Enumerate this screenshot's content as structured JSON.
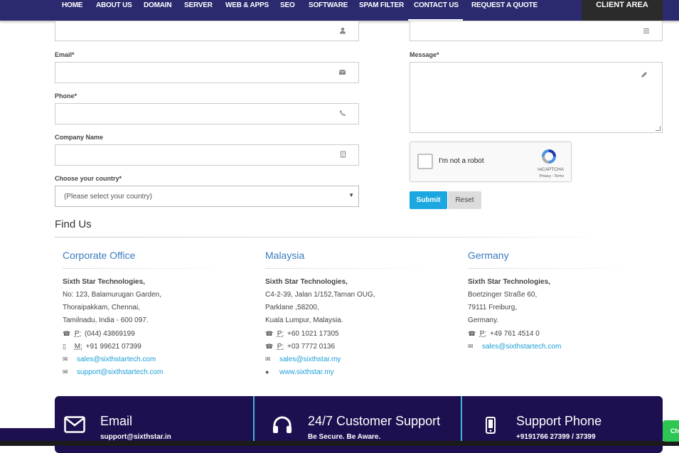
{
  "nav": {
    "items": [
      "HOME",
      "ABOUT US",
      "DOMAIN",
      "SERVER",
      "WEB & APPS",
      "SEO",
      "SOFTWARE",
      "SPAM FILTER",
      "CONTACT US",
      "REQUEST A QUOTE"
    ],
    "active": "CONTACT US",
    "client_area": "CLIENT AREA"
  },
  "form": {
    "email_label": "Email*",
    "phone_label": "Phone*",
    "company_label": "Company Name",
    "country_label": "Choose your country*",
    "country_selected": "(Please select your country)",
    "message_label": "Message*",
    "captcha_text": "I'm not a robot",
    "captcha_brand": "reCAPTCHA",
    "captcha_terms": "Privacy - Terms",
    "submit": "Submit",
    "reset": "Reset"
  },
  "find_us": {
    "heading": "Find Us",
    "offices": [
      {
        "title": "Corporate Office",
        "company": "Sixth Star Technologies,",
        "address": [
          "No: 123, Balamurugan Garden,",
          "Thoraipakkam, Chennai,",
          "Tamilnadu, India - 600 097."
        ],
        "contacts": [
          {
            "icon": "phone-icon",
            "key": "P:",
            "value": "(044) 43869199"
          },
          {
            "icon": "mobile-icon",
            "key": "M:",
            "value": "+91 99621 07399"
          }
        ],
        "links": [
          {
            "icon": "envelope-icon",
            "value": "sales@sixthstartech.com"
          },
          {
            "icon": "envelope-icon",
            "value": "support@sixthstartech.com"
          }
        ]
      },
      {
        "title": "Malaysia",
        "company": "Sixth Star Technologies,",
        "address": [
          "C4-2-39, Jalan 1/152,Taman OUG,",
          "Parklane ,58200,",
          "Kuala Lumpur, Malaysia."
        ],
        "contacts": [
          {
            "icon": "phone-icon",
            "key": "P:",
            "value": "+60 1021 17305"
          },
          {
            "icon": "phone-icon",
            "key": "P:",
            "value": "+03 7772 0136"
          }
        ],
        "links": [
          {
            "icon": "envelope-icon",
            "value": "sales@sixthstar.my"
          },
          {
            "icon": "globe-icon",
            "value": "www.sixthstar.my"
          }
        ]
      },
      {
        "title": "Germany",
        "company": "Sixth Star Technologies,",
        "address": [
          "Boetzinger Straße 60,",
          "79111 Freiburg,",
          "Germany."
        ],
        "contacts": [
          {
            "icon": "phone-icon",
            "key": "P:",
            "value": "+49 761 4514 0"
          }
        ],
        "links": [
          {
            "icon": "envelope-icon",
            "value": "sales@sixthstartech.com"
          }
        ]
      }
    ]
  },
  "banner": {
    "email_title": "Email",
    "email_sub": "support@sixthstar.in",
    "support_title": "24/7 Customer Support",
    "support_sub": "Be Secure. Be Aware.",
    "phone_title": "Support Phone",
    "phone_sub": "+9191766 27399 / 37399"
  },
  "chat_tab": "Ch"
}
